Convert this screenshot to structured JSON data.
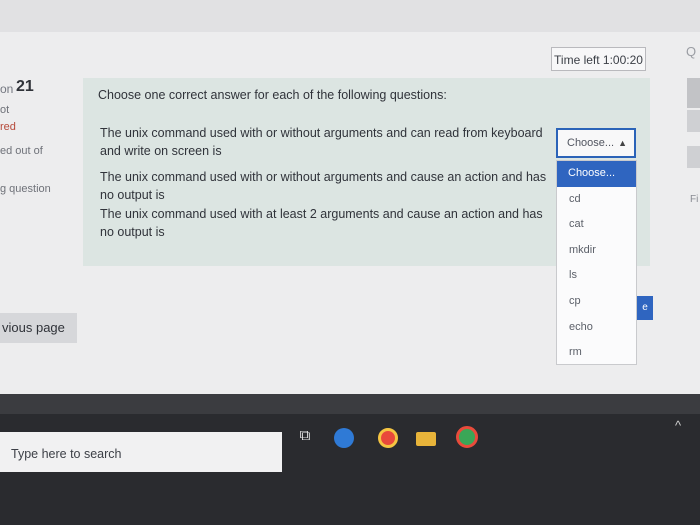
{
  "timer": {
    "label": "Time left 1:00:20"
  },
  "question_info": {
    "prefix": "on",
    "number": "21",
    "line1": "ot",
    "line2": "red",
    "line3": "ed out of",
    "line4": "g question"
  },
  "question": {
    "instructions": "Choose one correct answer for each of the following questions:",
    "items": [
      {
        "text": "The unix command used with or without arguments and can read from keyboard and write on screen is"
      },
      {
        "text": "The unix command used with or without arguments and cause an action and has no output  is"
      },
      {
        "text": "The unix command used with at least 2 arguments and cause an action and has no output  is"
      }
    ]
  },
  "select": {
    "current_value": "Choose...",
    "options": [
      "Choose...",
      "cd",
      "cat",
      "mkdir",
      "ls",
      "cp",
      "echo",
      "rm"
    ],
    "highlighted_index": 0
  },
  "right_partial": {
    "fi": "Fi",
    "button_char": "e"
  },
  "navigation": {
    "previous_page": "vious page"
  },
  "taskbar": {
    "search_placeholder": "Type here to search",
    "icons": [
      "task-view-icon",
      "edge-icon",
      "chrome-icon",
      "file-explorer-icon",
      "chrome-icon"
    ]
  },
  "colors": {
    "accent": "#2f65c0",
    "question_bg": "#dce5e2",
    "flag_red": "#b64a3a"
  }
}
